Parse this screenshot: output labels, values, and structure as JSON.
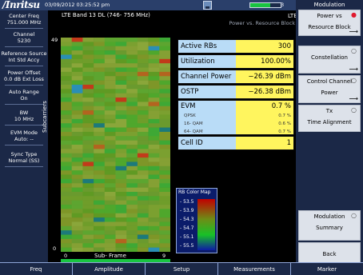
{
  "header": {
    "logo": "/Inritsu",
    "datetime": "03/09/2012 03:25:52 pm",
    "battery_level": 0.65,
    "battery_label": "3"
  },
  "left_params": [
    {
      "label": "Center Freq",
      "value": "751.000 MHz"
    },
    {
      "label": "Channel",
      "value": "5230"
    },
    {
      "label": "Reference Source",
      "value": "Int Std Accy"
    },
    {
      "label": "Power Offset",
      "value": "0.0 dB Ext Loss"
    },
    {
      "label": "Auto Range",
      "value": "On"
    },
    {
      "label": "BW",
      "value": "10 MHz"
    },
    {
      "label": "EVM Mode",
      "value": "Auto: --"
    },
    {
      "label": "Sync Type",
      "value": "Normal (SS)"
    }
  ],
  "band_title": "LTE Band 13 DL (746- 756 MHz)",
  "mode": "LTE",
  "mode_sub": "Power vs. Resource Block",
  "plot": {
    "y_top": "49",
    "y_bottom": "0",
    "y_label": "Subcarriers",
    "x_start": "0",
    "x_label": "Sub- Frame",
    "x_end": "9"
  },
  "results": {
    "active_rbs": {
      "label": "Active RBs",
      "value": "300"
    },
    "utilization": {
      "label": "Utilization",
      "value": "100.00%"
    },
    "channel_power": {
      "label": "Channel Power",
      "value": "−26.39 dBm"
    },
    "ostp": {
      "label": "OSTP",
      "value": "−26.38 dBm"
    },
    "evm": {
      "label": "EVM",
      "value": "0.7 %",
      "rows": [
        {
          "label": "QPSK",
          "value": "0.7 %"
        },
        {
          "label": "16- QAM",
          "value": "0.6 %"
        },
        {
          "label": "64- QAM",
          "value": "0.7 %"
        }
      ]
    },
    "cell_id": {
      "label": "Cell ID",
      "value": "1"
    }
  },
  "legend": {
    "title": "RB Color Map",
    "labels": [
      "- 53.5",
      "- 53.9",
      "- 54.3",
      "- 54.7",
      "- 55.1",
      "- 55.5"
    ]
  },
  "menu": {
    "title": "Modulation",
    "keys": [
      {
        "l1": "Power vs",
        "l2": "Resource Block",
        "indicator": "●",
        "active": true,
        "arrow": "⟶"
      },
      {
        "l1": "Constellation",
        "l2": "",
        "indicator": "○",
        "active": false,
        "arrow": "⟶"
      },
      {
        "l1": "Control Channel",
        "l2": "Power",
        "indicator": "○",
        "active": false,
        "arrow": "⟶"
      },
      {
        "l1": "Tx",
        "l2": "Time Alignment",
        "indicator": "○",
        "active": false,
        "arrow": ""
      },
      {
        "l1": "Modulation",
        "l2": "Summary",
        "indicator": "○",
        "active": false,
        "arrow": ""
      },
      {
        "l1": "Back",
        "l2": "",
        "indicator": "",
        "active": false,
        "arrow": "⟵"
      }
    ]
  },
  "bottom_menu": [
    "Freq",
    "Amplitude",
    "Setup",
    "Measurements",
    "Marker"
  ]
}
